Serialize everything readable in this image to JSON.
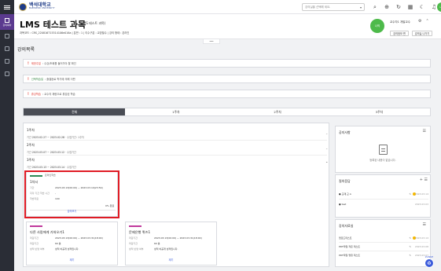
{
  "topbar": {
    "logo_kr": "백석대학교",
    "logo_en": "BAEKSEOK UNIVERSITY",
    "course_select_placeholder": "강의실을 선택해 세요.",
    "avatar_text": "나의",
    "icons": [
      "search-icon",
      "zoom-icon",
      "refresh-icon",
      "grid-icon",
      "moon-icon",
      "bell-icon"
    ]
  },
  "rail": {
    "active_label": "강의목차"
  },
  "header": {
    "title": "LMS 테스트 과목",
    "subtitle": "(LMS 테스트 과목)",
    "meta": "과목코드 : CRS_220816715314106e016a  |  분반 : 1  |  이수구분 : 교양필수  |  강의 형태 : 온라인",
    "prof_avatar": "나의",
    "prof_name": "교수자1 개발교수",
    "btn_edit": "강의정보 편",
    "btn_lecture": "강의실 나가기",
    "collapse": "━━"
  },
  "section_title": "강의목록",
  "notices": [
    {
      "key": "제한주일",
      "text": ": 수강/조회를 들어가야 할 확인"
    },
    {
      "key": "선택학습일",
      "text": ": 출결완료 학기에 의해 이편"
    },
    {
      "key": "휴강학습",
      "text": ": 교수의 재량으로 휴강된 학습"
    }
  ],
  "tabs": [
    "전체",
    "1주차",
    "2주차",
    "3주차"
  ],
  "weeks": [
    {
      "title": "1주차",
      "label": "기간",
      "range": "2023.02.27 ~ 2023.02.28",
      "extra": "· 수업기간: 1주차"
    },
    {
      "title": "2주차",
      "label": "기간",
      "range": "2023.03.07 ~ 2023.03.12",
      "extra": "· 수업기간"
    },
    {
      "title": "3주차",
      "label": "기간",
      "range": "2023.03.13 ~ 2023.03.14",
      "extra": "· 수업기간"
    }
  ],
  "cards": [
    {
      "badge": "온라인학습",
      "title": "1차시",
      "rows": [
        {
          "k": "기간",
          "v": "2023.03.13(00:00) ~ 2023.03.19(23:59)"
        },
        {
          "k": "지각 기간 학습 시간",
          "v": "-"
        },
        {
          "k": "학습자료",
          "v": "100"
        }
      ],
      "percent": "0% 완료",
      "link": "강의보기"
    },
    {
      "badge": "",
      "title": "다른 사람에게 가처오기1",
      "rows": [
        {
          "k": "마감기간",
          "v": "2023.03.13(00:00) ~ 2023.03.31(18:00)"
        },
        {
          "k": "마감기간",
          "v": "60 분"
        },
        {
          "k": "성적 반영 여부",
          "v": "성적 비공개 성적입니다."
        }
      ],
      "link": "제기"
    },
    {
      "badge": "",
      "title": "문제은행 퀴즈1",
      "rows": [
        {
          "k": "마감기간",
          "v": "2023.03.13(00:00) ~ 2023.03.31(18:00)"
        },
        {
          "k": "마감기간",
          "v": "60 분"
        },
        {
          "k": "성적 반영 여부",
          "v": "성적 비공개 성적입니다."
        }
      ],
      "link": "제기"
    }
  ],
  "panels": {
    "notice": {
      "title": "공지사항",
      "empty": "등록된 내용이 없습니다."
    },
    "qa": {
      "title": "질의응답",
      "rows": [
        {
          "text": "● 교재 교 A",
          "date": "2023.03.14"
        },
        {
          "text": "● test",
          "date": "2023.03.03"
        }
      ]
    },
    "resources": {
      "title": "강의자료실",
      "rows": [
        {
          "text": "업로드테스트",
          "date": "2023.03.14"
        },
        {
          "text": "PDF파일 작은 테스트",
          "date": "2023.03.08"
        },
        {
          "text": "PDF파일 명칭 테스트",
          "date": "2023.03.07"
        }
      ]
    }
  },
  "helper_badge": "ZANSH"
}
